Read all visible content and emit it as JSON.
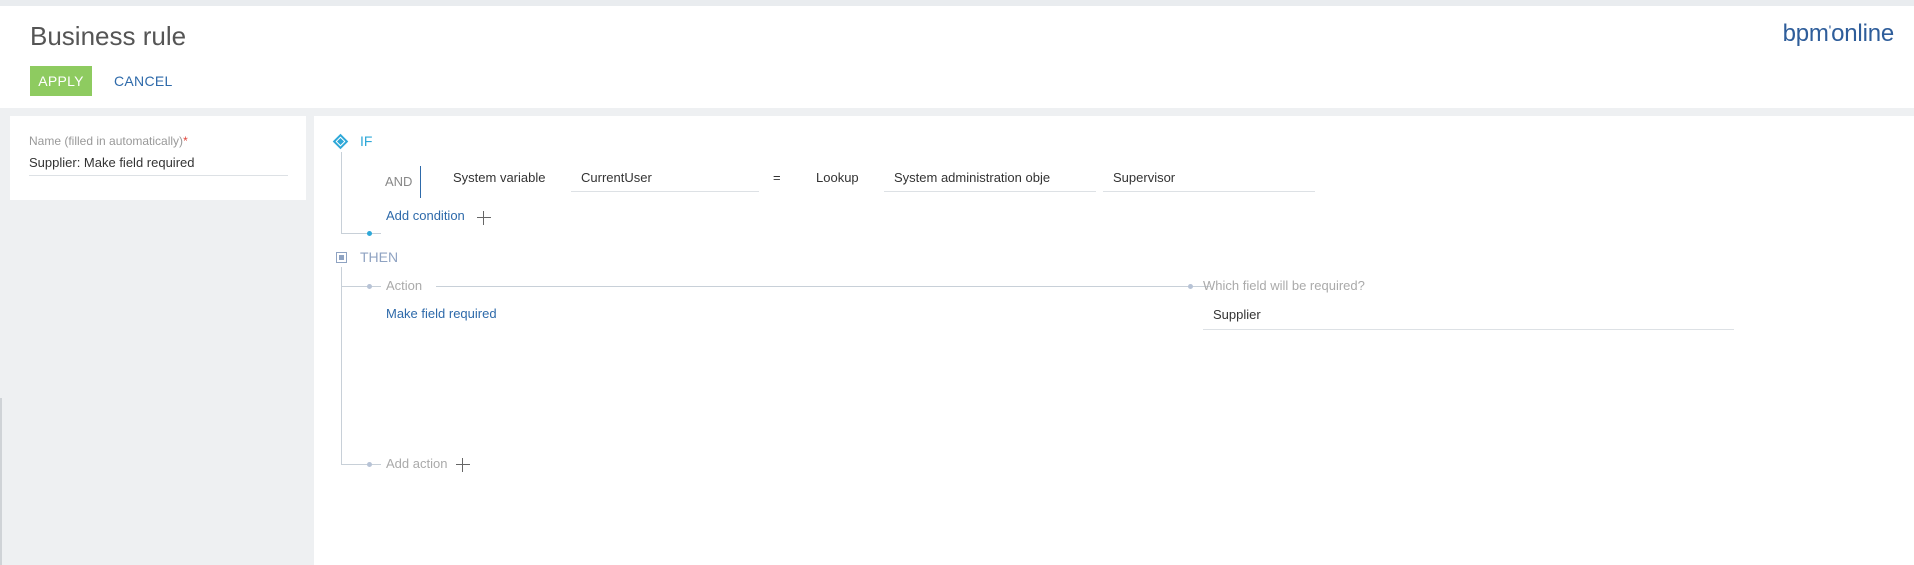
{
  "header": {
    "title": "Business rule",
    "logo": "bpm'online",
    "logo_main": "bpm",
    "logo_tick": "'",
    "logo_rest": "online",
    "apply_label": "APPLY",
    "cancel_label": "CANCEL"
  },
  "name_panel": {
    "label": "Name (filled in automatically)",
    "required_mark": "*",
    "value": "Supplier: Make field required"
  },
  "rule": {
    "if_label": "IF",
    "condition": {
      "operator": "AND",
      "left_type": "System variable",
      "left_value": "CurrentUser",
      "comparison": "=",
      "right_type": "Lookup",
      "right_lookup": "System administration obje",
      "right_value": "Supervisor"
    },
    "add_condition_label": "Add condition",
    "then_label": "THEN",
    "action_header": "Action",
    "field_header": "Which field will be required?",
    "action_value": "Make field required",
    "field_value": "Supplier",
    "add_action_label": "Add action"
  },
  "colors": {
    "apply_button": "#8ecb60",
    "link": "#2e6aaa",
    "if_accent": "#2ea8d8",
    "then_accent": "#8fa3c2",
    "required_mark": "#e0443a"
  }
}
